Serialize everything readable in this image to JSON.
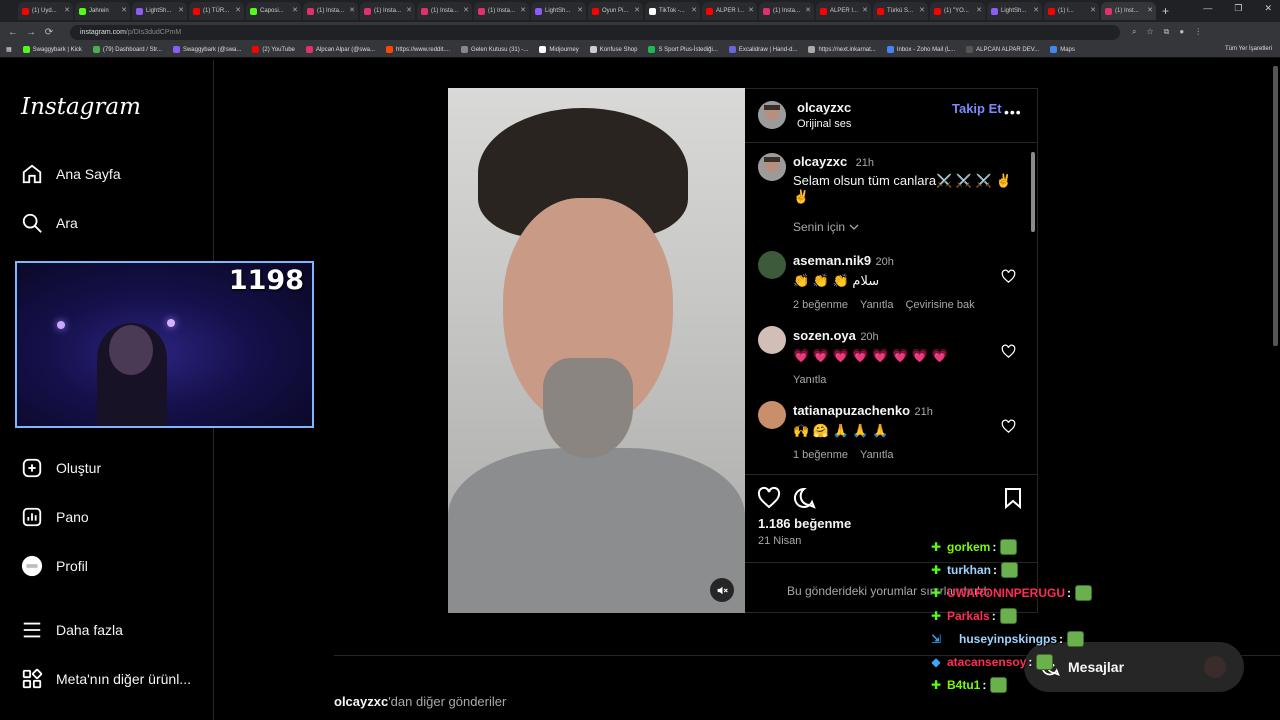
{
  "browser": {
    "tabs": [
      {
        "label": "(1) Uyd...",
        "color": "#ff0000"
      },
      {
        "label": "Jahrein",
        "color": "#53fc18"
      },
      {
        "label": "LightSh...",
        "color": "#8b5cf6"
      },
      {
        "label": "(1) TÜR...",
        "color": "#ff0000"
      },
      {
        "label": "Caposi...",
        "color": "#53fc18"
      },
      {
        "label": "(1) Insta...",
        "color": "#e1306c"
      },
      {
        "label": "(1) Insta...",
        "color": "#e1306c"
      },
      {
        "label": "(1) Insta...",
        "color": "#e1306c"
      },
      {
        "label": "(1) Insta...",
        "color": "#e1306c"
      },
      {
        "label": "LightSh...",
        "color": "#8b5cf6"
      },
      {
        "label": "Oyun Pi...",
        "color": "#ff0000"
      },
      {
        "label": "TikTok -...",
        "color": "#ffffff"
      },
      {
        "label": "ALPER I...",
        "color": "#ff0000"
      },
      {
        "label": "(1) Insta...",
        "color": "#e1306c"
      },
      {
        "label": "ALPER I...",
        "color": "#ff0000"
      },
      {
        "label": "Türkü S...",
        "color": "#ff0000"
      },
      {
        "label": "(1) \"YO...",
        "color": "#ff0000"
      },
      {
        "label": "LightSh...",
        "color": "#8b5cf6"
      },
      {
        "label": "(1) I...",
        "color": "#ff0000"
      },
      {
        "label": "(1) Inst...",
        "color": "#e1306c"
      }
    ],
    "url_host": "instagram.com",
    "url_path": "/p/DIs3dudCPmM",
    "bookmarks": [
      "Swaggybark | Kick",
      "(79) Dashboard / Str...",
      "Swaggybark (@swa...",
      "(2) YouTube",
      "Alpcan Alpar (@swa...",
      "https://www.reddit....",
      "Gelen Kutusu (31) -...",
      "Midjourney",
      "Konfuse Shop",
      "S Sport Plus-İstediği...",
      "Excalidraw | Hand-d...",
      "https://next.inkarnat...",
      "Inbox - Zoho Mail (L...",
      "ALPCAN ALPAR DEV...",
      "Maps"
    ],
    "bookmarks_right": "Tüm Yer İşaretleri"
  },
  "sidebar": {
    "logo": "Instagram",
    "items": [
      {
        "label": "Ana Sayfa",
        "icon": "home-icon"
      },
      {
        "label": "Ara",
        "icon": "search-icon"
      },
      {
        "label": "Oluştur",
        "icon": "plus-square-icon"
      },
      {
        "label": "Pano",
        "icon": "dashboard-icon"
      },
      {
        "label": "Profil",
        "icon": "avatar-icon"
      },
      {
        "label": "Daha fazla",
        "icon": "menu-icon"
      },
      {
        "label": "Meta'nın diğer ürünl...",
        "icon": "meta-apps-icon"
      }
    ]
  },
  "webcam": {
    "counter": "1198"
  },
  "post": {
    "author": "olcayzxc",
    "audio": "Orijinal ses",
    "follow_label": "Takip Et",
    "more": "•••",
    "caption": {
      "user": "olcayzxc",
      "time": "21h",
      "text": "Selam olsun tüm canlara⚔️ ⚔️ ⚔️ ✌️ ✌️"
    },
    "sort_label": "Senin için",
    "comments": [
      {
        "user": "aseman.nik9",
        "time": "20h",
        "text": "👏 👏 👏 سلام",
        "meta": [
          "2 beğenme",
          "Yanıtla",
          "Çevirisine bak"
        ]
      },
      {
        "user": "sozen.oya",
        "time": "20h",
        "text": "💗 💗 💗 💗 💗 💗 💗 💗",
        "meta": [
          "Yanıtla"
        ]
      },
      {
        "user": "tatianapuzachenko",
        "time": "21h",
        "text": "🙌 🤗 🙏 🙏 🙏",
        "meta": [
          "1 beğenme",
          "Yanıtla"
        ]
      }
    ],
    "likes": "1.186 beğenme",
    "date": "21 Nisan",
    "comment_placeholder": "Bu gönderideki yorumlar sınırlandırıldı."
  },
  "more_posts": {
    "user": "olcayzxc",
    "suffix": "'dan diğer gönderiler"
  },
  "messages": {
    "label": "Mesajlar"
  },
  "chat": [
    {
      "user": "gorkem",
      "color": "#7cfc00",
      "badge": "✚",
      "badge_color": "#53fc18"
    },
    {
      "user": "turkhan",
      "color": "#9fd3ff",
      "badge": "✚",
      "badge_color": "#53fc18"
    },
    {
      "user": "UWARONINPERUGU",
      "color": "#ff2d55",
      "badge": "✚",
      "badge_color": "#53fc18"
    },
    {
      "user": "Parkals",
      "color": "#ff2d55",
      "badge": "✚",
      "badge_color": "#53fc18"
    },
    {
      "user": "huseyinpskingps",
      "color": "#9fd3ff",
      "badge": "⇲",
      "badge_color": "#3ea6ff"
    },
    {
      "user": "atacansensoy",
      "color": "#ff2d55",
      "badge": "◆",
      "badge_color": "#3ea6ff"
    },
    {
      "user": "B4tu1",
      "color": "#7cfc00",
      "badge": "✚",
      "badge_color": "#53fc18"
    }
  ]
}
